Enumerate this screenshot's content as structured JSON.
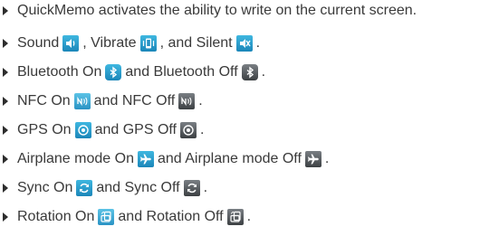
{
  "items": [
    {
      "segments": [
        "QuickMemo activates the ability to write on the current screen."
      ]
    },
    {
      "segments": [
        "Sound",
        ", Vibrate",
        ", and Silent",
        "."
      ]
    },
    {
      "segments": [
        "Bluetooth On",
        " and Bluetooth Off",
        "."
      ]
    },
    {
      "segments": [
        "NFC On",
        " and NFC Off",
        "."
      ]
    },
    {
      "segments": [
        "GPS On",
        " and GPS Off",
        "."
      ]
    },
    {
      "segments": [
        "Airplane mode On",
        " and Airplane mode Off",
        "."
      ]
    },
    {
      "segments": [
        "Sync On",
        " and Sync Off",
        "."
      ]
    },
    {
      "segments": [
        "Rotation On",
        " and Rotation Off",
        "."
      ]
    }
  ],
  "icons": {
    "sound": "sound-icon",
    "vibrate": "vibrate-icon",
    "silent": "silent-icon",
    "bluetooth_on": "bluetooth-on-icon",
    "bluetooth_off": "bluetooth-off-icon",
    "nfc_on": "nfc-on-icon",
    "nfc_off": "nfc-off-icon",
    "gps_on": "gps-on-icon",
    "gps_off": "gps-off-icon",
    "airplane_on": "airplane-on-icon",
    "airplane_off": "airplane-off-icon",
    "sync_on": "sync-on-icon",
    "sync_off": "sync-off-icon",
    "rotation_on": "rotation-on-icon",
    "rotation_off": "rotation-off-icon"
  },
  "colors": {
    "text": "#3a3a3a",
    "icon_on": "#1b86b9",
    "icon_off": "#3c4043"
  }
}
